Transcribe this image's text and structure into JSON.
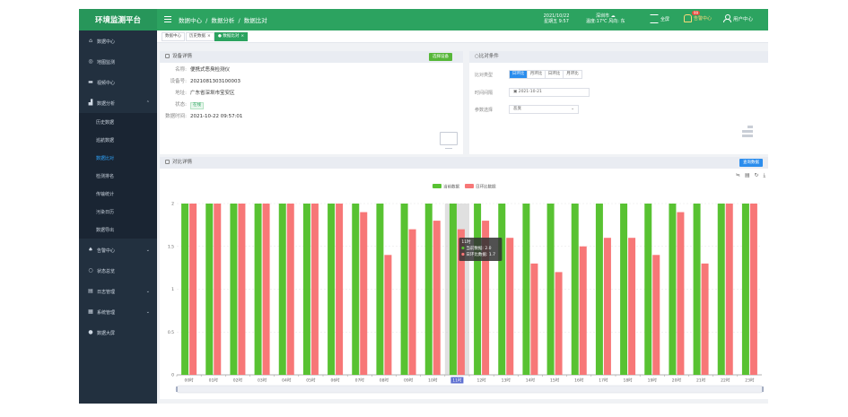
{
  "app": {
    "brand": "环境监测平台",
    "breadcrumb": [
      "数据中心",
      "/",
      "数据分析",
      "/",
      "数据比对"
    ],
    "date": "2021/10/22",
    "time": "星期五 9:57",
    "city": "深圳市",
    "weather": "温度:17℃ 风向: 东",
    "fullscreen": "全屏",
    "alarm_label": "告警中心",
    "alarm_count": "99",
    "user_label": "用户中心"
  },
  "sidebar": {
    "items": [
      {
        "label": "数据中心",
        "icon": "home-icon"
      },
      {
        "label": "地图监测",
        "icon": "map-icon"
      },
      {
        "label": "视频中心",
        "icon": "camera-icon"
      },
      {
        "label": "数据分析",
        "icon": "chart-icon"
      },
      {
        "label": "告警中心",
        "icon": "bell-icon"
      },
      {
        "label": "状态总览",
        "icon": "circle-icon"
      },
      {
        "label": "日志管理",
        "icon": "log-icon"
      },
      {
        "label": "系统管理",
        "icon": "settings-icon"
      },
      {
        "label": "数据大屏",
        "icon": "pin-icon"
      }
    ],
    "subitems": [
      "历史数据",
      "巡航数据",
      "数据比对",
      "检测排名",
      "传输统计",
      "污染日历",
      "数据导出"
    ]
  },
  "tabs": [
    {
      "label": "数据中心"
    },
    {
      "label": "历史数据"
    },
    {
      "label": "数据比对"
    }
  ],
  "device": {
    "title": "设备详情",
    "select_btn": "选择设备",
    "rows": [
      {
        "label": "名称:",
        "value": "便携式恶臭检测仪"
      },
      {
        "label": "设备号:",
        "value": "2021081303100003"
      },
      {
        "label": "地址:",
        "value": "广东省深圳市宝安区"
      },
      {
        "label": "状态:",
        "value": "在线"
      },
      {
        "label": "数据时间:",
        "value": "2021-10-22 09:57:01"
      }
    ]
  },
  "compare": {
    "title": "比对条件",
    "type_label": "比对类型",
    "types": [
      "日环比",
      "月环比",
      "日环比",
      "月环比"
    ],
    "time_label": "时间间隔",
    "date_value": "2021-10-21",
    "param_label": "参数选择",
    "param_value": "恶臭"
  },
  "detail": {
    "title": "对比详情",
    "query_btn": "查询数据",
    "toolbox": "≒ ▤ ↻ ⤓"
  },
  "chart_data": {
    "type": "bar",
    "categories": [
      "00时",
      "01时",
      "02时",
      "03时",
      "04时",
      "05时",
      "06时",
      "07时",
      "08时",
      "09时",
      "10时",
      "11时",
      "12时",
      "13时",
      "14时",
      "15时",
      "16时",
      "17时",
      "18时",
      "19时",
      "20时",
      "21时",
      "22时",
      "23时"
    ],
    "series": [
      {
        "name": "当前数据",
        "values": [
          2,
          2,
          2,
          2,
          2,
          2,
          2,
          2,
          2,
          2,
          2,
          2,
          2,
          2,
          2,
          2,
          2,
          2,
          2,
          2,
          2,
          2,
          2,
          2
        ]
      },
      {
        "name": "日环比数据",
        "values": [
          2,
          2,
          2,
          2,
          2,
          2,
          2,
          1.9,
          1.4,
          1.7,
          1.8,
          1.7,
          1.8,
          1.6,
          1.3,
          1.2,
          1.5,
          1.6,
          1.6,
          1.4,
          1.9,
          1.3,
          2,
          2
        ]
      }
    ],
    "ylim": [
      0,
      2
    ],
    "yticks": [
      "0",
      "0.5",
      "1",
      "1.5",
      "2"
    ],
    "colors": {
      "current": "#58c232",
      "prev": "#f77777"
    },
    "tooltip": {
      "title": "11时",
      "lines": [
        "当前数据: 2.0",
        "日环比数据: 1.7"
      ]
    },
    "highlight_index": 11
  }
}
